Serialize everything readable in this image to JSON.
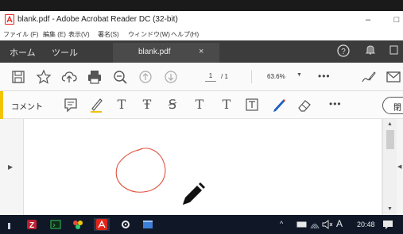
{
  "window": {
    "title": "blank.pdf - Adobe Acrobat Reader DC (32-bit)",
    "minimize": "–",
    "maximize": "□"
  },
  "menu": [
    "ファイル (F)",
    "編集 (E)",
    "表示(V)",
    "署名(S)",
    "ウィンドウ(W)",
    "ヘルプ(H)"
  ],
  "tabs": {
    "home": "ホーム",
    "tools": "ツール",
    "document": "blank.pdf",
    "close": "×"
  },
  "toolbar": {
    "current_page": "1",
    "total_pages": "/ 1",
    "zoom": "63.6%",
    "more": "•••"
  },
  "comment_bar": {
    "label": "コメント",
    "text_tools": [
      "T",
      "Ŧ",
      "Ꞩ",
      "T",
      "T"
    ],
    "more": "•••",
    "close_label": "閉"
  },
  "taskbar": {
    "lang": "A",
    "clock": "20:48"
  },
  "colors": {
    "acrobat_red": "#e2231a",
    "highlight_yellow": "#f2c400",
    "drawn_circle": "#e0533d",
    "tabbar_bg": "#3c3c3c",
    "taskbar_bg": "#101828"
  }
}
